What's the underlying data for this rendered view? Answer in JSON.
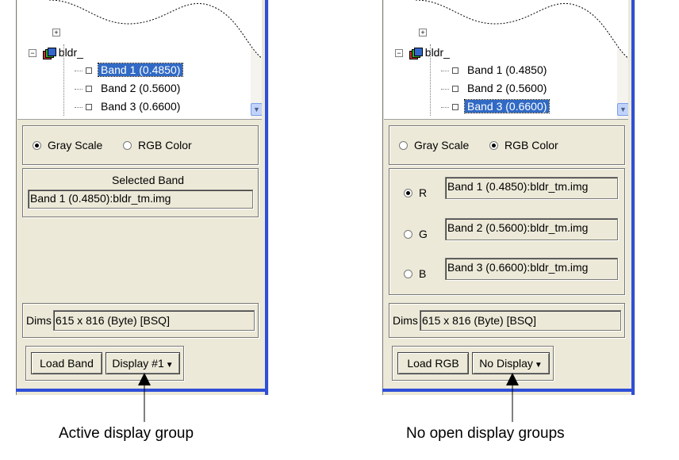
{
  "left_panel": {
    "tree": {
      "root_label": "bldr_",
      "items": [
        {
          "label": "Band 1 (0.4850)",
          "selected": true
        },
        {
          "label": "Band 2 (0.5600)",
          "selected": false
        },
        {
          "label": "Band 3 (0.6600)",
          "selected": false
        }
      ]
    },
    "mode": {
      "gray_label": "Gray Scale",
      "rgb_label": "RGB Color",
      "selected": "gray"
    },
    "selected_band": {
      "title": "Selected Band",
      "value": "Band 1 (0.4850):bldr_tm.img"
    },
    "dims": {
      "label": "Dims",
      "value": "615 x 816 (Byte) [BSQ]"
    },
    "load_button": "Load Band",
    "display_dropdown": "Display #1"
  },
  "right_panel": {
    "tree": {
      "root_label": "bldr_",
      "items": [
        {
          "label": "Band 1 (0.4850)",
          "selected": false
        },
        {
          "label": "Band 2 (0.5600)",
          "selected": false
        },
        {
          "label": "Band 3 (0.6600)",
          "selected": true
        }
      ]
    },
    "mode": {
      "gray_label": "Gray Scale",
      "rgb_label": "RGB Color",
      "selected": "rgb"
    },
    "channels": [
      {
        "label": "R",
        "value": "Band 1 (0.4850):bldr_tm.img",
        "selected": true
      },
      {
        "label": "G",
        "value": "Band 2 (0.5600):bldr_tm.img",
        "selected": false
      },
      {
        "label": "B",
        "value": "Band 3 (0.6600):bldr_tm.img",
        "selected": false
      }
    ],
    "dims": {
      "label": "Dims",
      "value": "615 x 816 (Byte) [BSQ]"
    },
    "load_button": "Load RGB",
    "display_dropdown": "No Display"
  },
  "captions": {
    "left": "Active display group",
    "right": "No open display groups"
  },
  "colors": {
    "panel_bg": "#ece9d8",
    "selection": "#316ac5",
    "frame_blue": "#2f4fd8"
  }
}
